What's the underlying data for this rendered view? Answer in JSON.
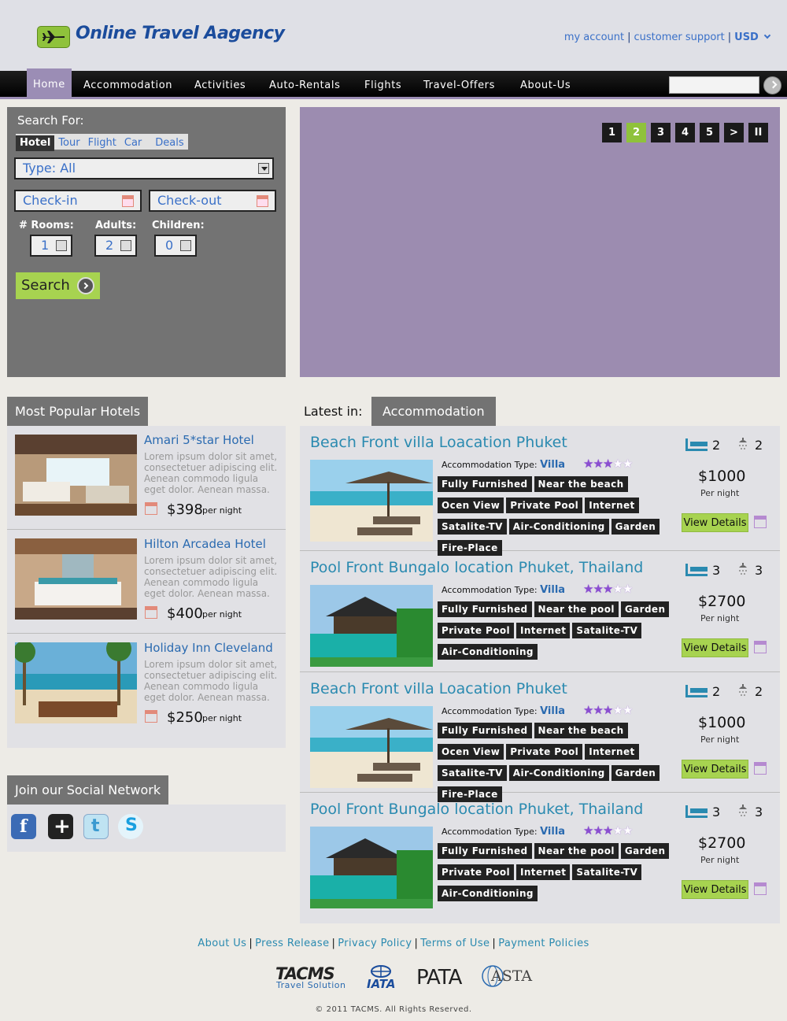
{
  "header": {
    "logo_text": "Online Travel Aagency",
    "links": [
      "my account",
      "customer support",
      "USD"
    ]
  },
  "nav": {
    "items": [
      "Home",
      "Accommodation",
      "Activities",
      "Auto-Rentals",
      "Flights",
      "Travel-Offers",
      "About-Us"
    ],
    "search_value": ""
  },
  "search": {
    "title": "Search For:",
    "tabs": [
      "Hotel",
      "Tour",
      "Flight",
      "Car",
      "Deals"
    ],
    "type": "Type: All",
    "checkin": "Check-in",
    "checkout": "Check-out",
    "rooms_label": "# Rooms:",
    "adults_label": "Adults:",
    "children_label": "Children:",
    "rooms": "1",
    "adults": "2",
    "children": "0",
    "button": "Search"
  },
  "slider": {
    "pages": [
      "1",
      "2",
      "3",
      "4",
      "5",
      ">",
      "II"
    ],
    "active_page": "2"
  },
  "popular": {
    "title": "Most Popular Hotels",
    "hotels": [
      {
        "name": "Amari 5*star Hotel",
        "desc": "Lorem ipsum dolor sit amet, consectetuer adipiscing elit. Aenean commodo ligula eget dolor. Aenean massa.",
        "price": "$398",
        "per": "per night"
      },
      {
        "name": "Hilton Arcadea Hotel",
        "desc": "Lorem ipsum dolor sit amet, consectetuer adipiscing elit. Aenean commodo ligula eget dolor. Aenean massa.",
        "price": "$400",
        "per": "per night"
      },
      {
        "name": "Holiday Inn Cleveland",
        "desc": "Lorem ipsum dolor sit amet, consectetuer adipiscing elit. Aenean commodo ligula eget dolor. Aenean massa.",
        "price": "$250",
        "per": "per night"
      }
    ]
  },
  "social": {
    "title": "Join our Social Network",
    "icons": [
      "facebook-icon",
      "google-plus-icon",
      "twitter-icon",
      "skype-icon"
    ]
  },
  "latest": {
    "label": "Latest in:",
    "category": "Accommodation",
    "type_label": "Accommodation Type:",
    "items": [
      {
        "title": "Beach Front villa Loacation Phuket",
        "type": "Villa",
        "tags": [
          "Fully Furnished",
          "Near the beach",
          "Ocen View",
          "Private Pool",
          "Internet",
          "Satalite-TV",
          "Air-Conditioning",
          "Garden",
          "Fire-Place"
        ],
        "beds": "2",
        "baths": "2",
        "price": "$1000",
        "per": "Per night",
        "button": "View Details",
        "rating": 3
      },
      {
        "title": "Pool Front Bungalo location Phuket, Thailand",
        "type": "Villa",
        "tags": [
          "Fully Furnished",
          "Near the pool",
          "Garden",
          "Private Pool",
          "Internet",
          "Satalite-TV",
          "Air-Conditioning"
        ],
        "beds": "3",
        "baths": "3",
        "price": "$2700",
        "per": "Per night",
        "button": "View Details",
        "rating": 3
      },
      {
        "title": "Beach Front villa Loacation Phuket",
        "type": "Villa",
        "tags": [
          "Fully Furnished",
          "Near the beach",
          "Ocen View",
          "Private Pool",
          "Internet",
          "Satalite-TV",
          "Air-Conditioning",
          "Garden",
          "Fire-Place"
        ],
        "beds": "2",
        "baths": "2",
        "price": "$1000",
        "per": "Per night",
        "button": "View Details",
        "rating": 3
      },
      {
        "title": "Pool Front Bungalo location Phuket, Thailand",
        "type": "Villa",
        "tags": [
          "Fully Furnished",
          "Near the pool",
          "Garden",
          "Private Pool",
          "Internet",
          "Satalite-TV",
          "Air-Conditioning"
        ],
        "beds": "3",
        "baths": "3",
        "price": "$2700",
        "per": "Per night",
        "button": "View Details",
        "rating": 3
      }
    ]
  },
  "footer": {
    "links": [
      "About Us",
      "Press Release",
      "Privacy Policy",
      "Terms of Use",
      "Payment Policies"
    ],
    "partners": [
      "TACMS",
      "Travel Solution",
      "IATA",
      "PATA",
      "ASTA"
    ],
    "copyright": "© 2011 TACMS. All Rights Reserved."
  },
  "colors": {
    "accent_purple": "#9b8db5",
    "accent_green": "#a7d350",
    "link_blue": "#2a8ab0"
  }
}
